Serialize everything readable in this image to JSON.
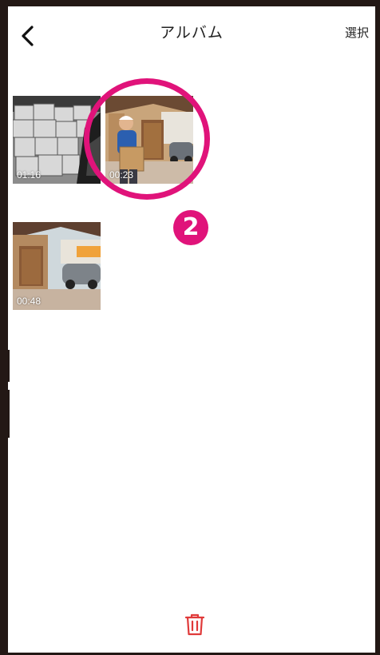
{
  "navbar": {
    "title": "アルバム",
    "select_label": "選択",
    "back_icon": "chevron-left-icon"
  },
  "album": {
    "items": [
      {
        "duration": "01:16",
        "scene": "stacked cardboard boxes (grayscale)"
      },
      {
        "duration": "00:23",
        "scene": "delivery person holding box at garage"
      },
      {
        "duration": "00:48",
        "scene": "house with garage and parked car"
      }
    ]
  },
  "annotation": {
    "step_number": "2",
    "color": "#e0137a"
  },
  "toolbar": {
    "delete_icon": "trash-icon",
    "delete_color": "#e03a3a"
  },
  "colors": {
    "frame": "#231815",
    "background": "#ffffff",
    "accent": "#e0137a"
  }
}
